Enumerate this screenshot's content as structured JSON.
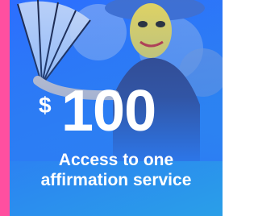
{
  "offer": {
    "currency": "$",
    "amount": "100",
    "caption_line1": "Access to one",
    "caption_line2": "affirmation service"
  },
  "colors": {
    "accent_stripe": "#ff4fa0",
    "panel_blue": "#2c7cf4",
    "text": "#ffffff"
  },
  "image": {
    "subject_icon": "festival-performer-photo"
  }
}
